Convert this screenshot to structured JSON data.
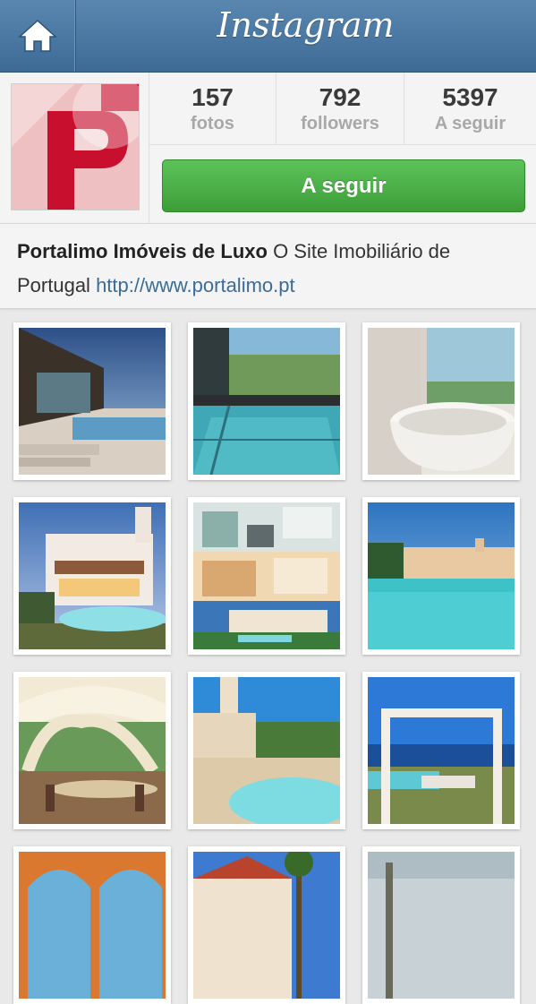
{
  "header": {
    "title": "Instagram",
    "home_icon": "home-icon"
  },
  "profile": {
    "stats": [
      {
        "value": "157",
        "label": "fotos"
      },
      {
        "value": "792",
        "label": "followers"
      },
      {
        "value": "5397",
        "label": "A seguir"
      }
    ],
    "follow_button": "A seguir",
    "bio": {
      "name": "Portalimo Imóveis de Luxo",
      "description": " O Site Imobiliário de Portugal ",
      "link": "http://www.portalimo.pt"
    }
  },
  "colors": {
    "navbar": "#4a79a3",
    "follow_green": "#4db049",
    "link": "#3b6c98",
    "avatar_red": "#c8102e"
  },
  "photos": [
    "modern-house-terrace",
    "indoor-pool",
    "freestanding-bathtub",
    "white-villa-pool",
    "kitchen-collage",
    "mediterranean-villa-pool",
    "covered-dining-patio",
    "garden-pool-chimney",
    "sea-view-pergola",
    "arched-window",
    "red-roof-villa",
    "palm-tree-terrace"
  ]
}
